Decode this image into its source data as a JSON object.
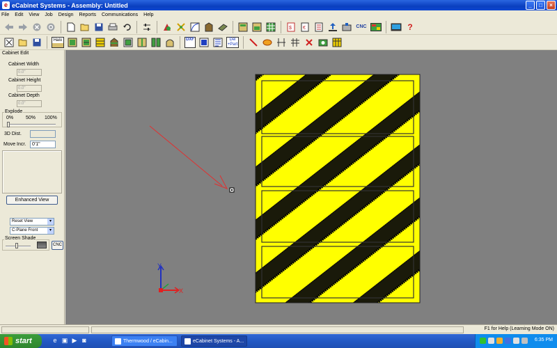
{
  "window": {
    "title": "eCabinet Systems - Assembly: Untitled",
    "app_icon": "e"
  },
  "window_buttons": {
    "minimize": "_",
    "maximize": "□",
    "close": "×"
  },
  "menu": [
    "File",
    "Edit",
    "View",
    "Job",
    "Design",
    "Reports",
    "Communications",
    "Help"
  ],
  "toolbar1": {
    "back_icon": "arrow-left-icon",
    "forward_icon": "arrow-right-icon",
    "cnc_label": "CNC",
    "help_glyph": "?"
  },
  "toolbar2": {
    "halo_label": "Halo",
    "dxf_label": "DXF",
    "del_label": "Del",
    "part_label": "+Part"
  },
  "left_panel": {
    "cabinet_edit_label": "Cabinet Edit",
    "cabinet_width_label": "Cabinet Width",
    "cabinet_width_value": "0.0\"",
    "cabinet_height_label": "Cabinet Height",
    "cabinet_height_value": "0.0\"",
    "cabinet_depth_label": "Cabinet Depth",
    "cabinet_depth_value": "0.0\"",
    "explode_label": "Explode",
    "explode_ticks": [
      "0%",
      "50%",
      "100%"
    ],
    "explode_level": 0,
    "dist_3d_label": "3D Dist.",
    "dist_3d_value": "",
    "move_incr_label": "Move Incr.",
    "move_incr_value": "0'1\"",
    "enhanced_view_label": "Enhanced View",
    "reset_view_value": "Reset View",
    "cplane_value": "C-Plane Front",
    "screen_shade_label": "Screen Shade",
    "cnc_button_label": "CNC"
  },
  "axes": {
    "x_label": "X",
    "y_label": "Y",
    "x_color": "#e02020",
    "y_color": "#2030c0",
    "z_color": "#20a040"
  },
  "status_text": "F1 for Help (Learning Mode ON)",
  "taskbar": {
    "start_label": "start",
    "tasks": [
      {
        "label": "Thermwood / eCabin...",
        "active": false
      },
      {
        "label": "eCabinet Systems - A...",
        "active": true
      }
    ],
    "clock": "6:35 PM"
  },
  "colors": {
    "cabinet_yellow": "#ffff00",
    "viewport_gray": "#808080",
    "title_blue": "#0a3fbf",
    "arrow_red": "#e03030"
  }
}
